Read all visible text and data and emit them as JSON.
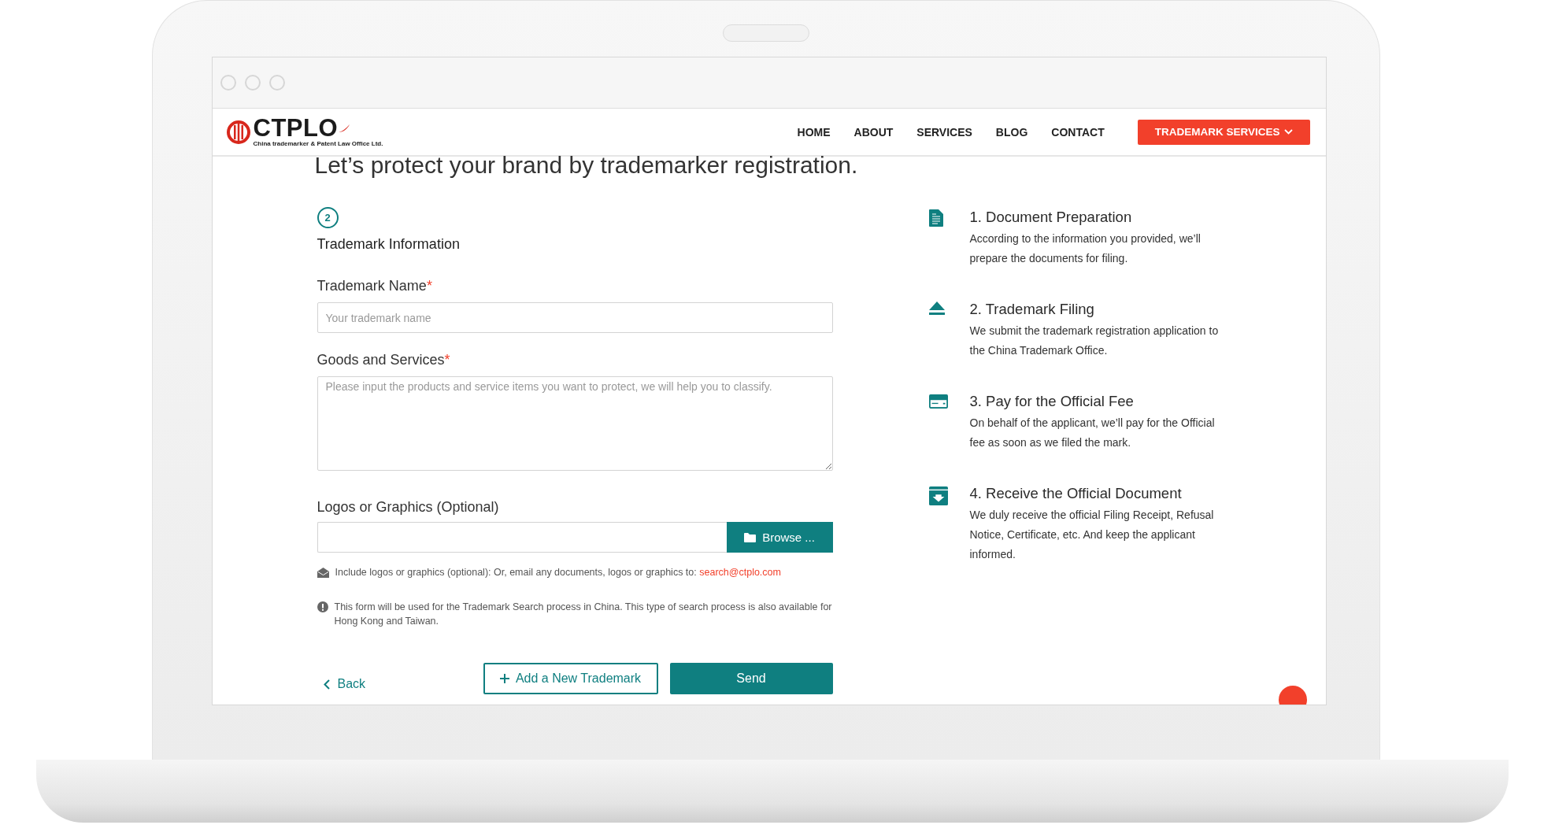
{
  "header": {
    "logo": {
      "name": "CTPLO",
      "tagline": "China trademarker & Patent Law Office Ltd."
    },
    "nav": [
      {
        "label": "HOME"
      },
      {
        "label": "ABOUT"
      },
      {
        "label": "SERVICES"
      },
      {
        "label": "BLOG"
      },
      {
        "label": "CONTACT"
      }
    ],
    "cta": "TRADEMARK SERVICES"
  },
  "heading": "Let’s protect your brand by trademarker registration.",
  "step": {
    "number": "2",
    "title": "Trademark Information"
  },
  "fields": [
    {
      "kind": "input",
      "label": "Trademark Name",
      "required_mark": "*",
      "placeholder": "Your trademark name"
    },
    {
      "kind": "textarea",
      "label": "Goods and Services",
      "required_mark": "*",
      "placeholder": "Please input the products and service items you want to protect, we will help you to classify."
    },
    {
      "kind": "file",
      "label": "Logos or Graphics (Optional)",
      "button": "Browse ..."
    }
  ],
  "notes": [
    {
      "kind": "email",
      "text": "Include logos or graphics (optional): Or, email any documents, logos or graphics to:",
      "link": "search@ctplo.com"
    },
    {
      "kind": "info",
      "text": "This form will be used for the Trademark Search process in China. This type of search process is also available for Hong Kong and Taiwan."
    }
  ],
  "actions": {
    "back": "Back",
    "add": "Add a New Trademark",
    "send": "Send"
  },
  "steps": [
    {
      "kind": "document",
      "title": "1. Document Preparation",
      "text": "According to the information you provided, we’ll prepare the documents for filing."
    },
    {
      "kind": "filing",
      "title": "2. Trademark Filing",
      "text": "We submit the trademark registration application to the China Trademark Office."
    },
    {
      "kind": "payment",
      "title": "3. Pay for the Official Fee",
      "text": "On behalf of the applicant, we’ll pay for the Official fee as soon as we filed the mark."
    },
    {
      "kind": "receive",
      "title": "4. Receive the Official Document",
      "text": "We duly receive the official Filing Receipt, Refusal Notice, Certificate, etc. And keep the applicant informed."
    }
  ]
}
